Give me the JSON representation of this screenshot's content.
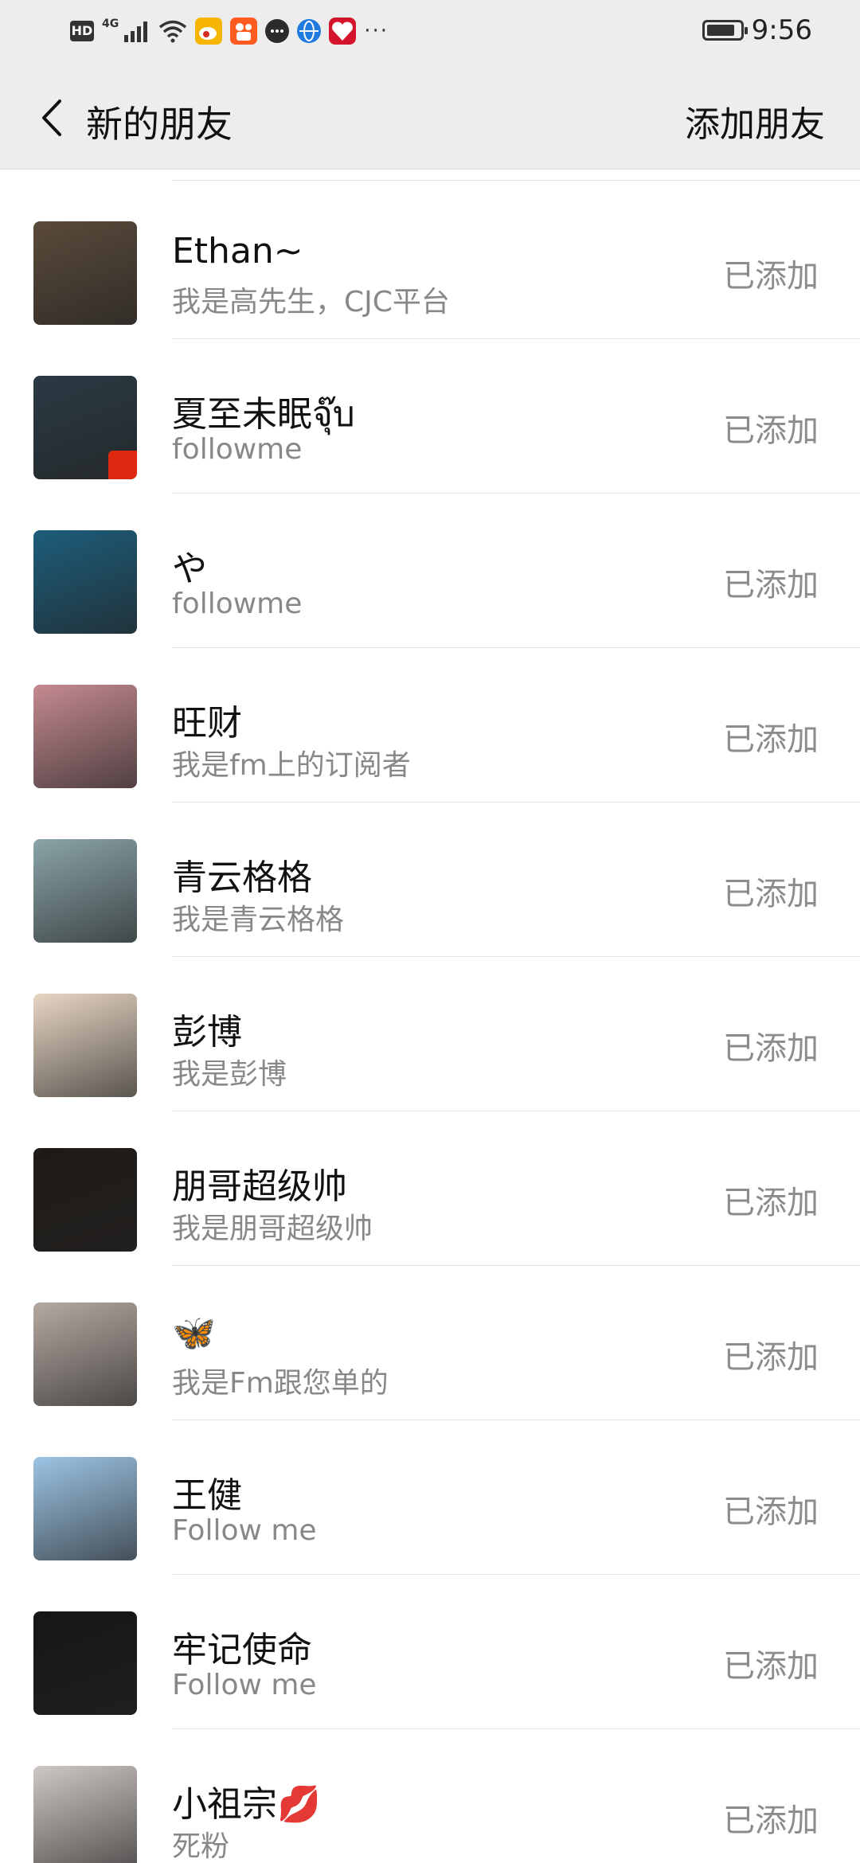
{
  "status_bar": {
    "hd": "HD",
    "network": "4G",
    "time": "9:56",
    "dots": "···",
    "icons": [
      "signal-icon",
      "wifi-icon",
      "weibo-icon",
      "kuaishou-icon",
      "message-icon",
      "globe-icon",
      "love-app-icon",
      "battery-icon"
    ]
  },
  "header": {
    "title": "新的朋友",
    "action": "添加朋友",
    "back_icon": "chevron-left-icon"
  },
  "friends": [
    {
      "name": "Ethan~",
      "message": "我是高先生，CJC平台",
      "status": "已添加",
      "avatar_color": "#5a4a3a"
    },
    {
      "name": "夏至未眠จุ๊บ",
      "message": "followme",
      "status": "已添加",
      "avatar_color": "#2a3a44"
    },
    {
      "name": "や",
      "message": "followme",
      "status": "已添加",
      "avatar_color": "#1d5d7a"
    },
    {
      "name": "旺财",
      "message": "我是fm上的订阅者",
      "status": "已添加",
      "avatar_color": "#c48a90"
    },
    {
      "name": "青云格格",
      "message": "我是青云格格",
      "status": "已添加",
      "avatar_color": "#8aa4a8"
    },
    {
      "name": "彭博",
      "message": "我是彭博",
      "status": "已添加",
      "avatar_color": "#e8d6c4"
    },
    {
      "name": "朋哥超级帅",
      "message": "我是朋哥超级帅",
      "status": "已添加",
      "avatar_color": "#1f1a16"
    },
    {
      "name": "🦋",
      "message": "我是Fm跟您单的",
      "status": "已添加",
      "avatar_color": "#b5a9a2"
    },
    {
      "name": "王健",
      "message": "Follow  me",
      "status": "已添加",
      "avatar_color": "#9cc4e4"
    },
    {
      "name": "牢记使命",
      "message": "Follow me",
      "status": "已添加",
      "avatar_color": "#161616"
    },
    {
      "name": "小祖宗💋",
      "message": "死粉",
      "status": "已添加",
      "avatar_color": "#cfc8c4"
    }
  ]
}
